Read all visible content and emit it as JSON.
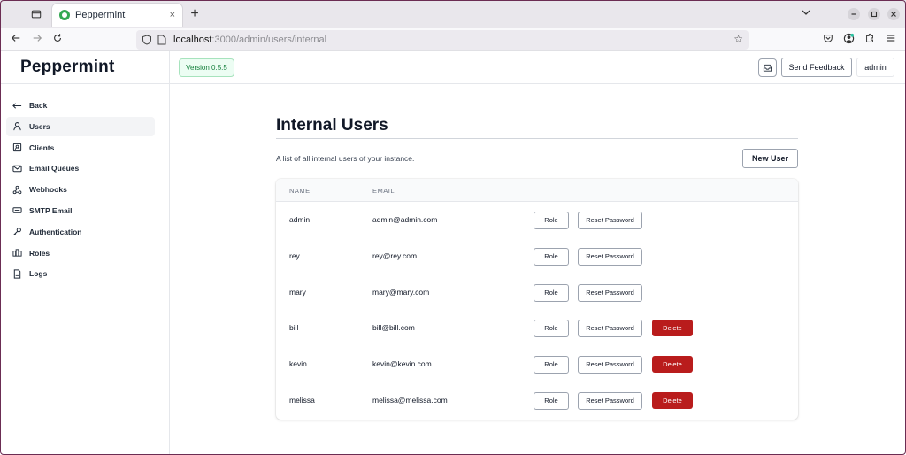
{
  "browser": {
    "tab_title": "Peppermint",
    "tab_close": "×",
    "new_tab": "+",
    "url_host": "localhost",
    "url_path": ":3000/admin/users/internal"
  },
  "app": {
    "brand": "Peppermint",
    "version": "Version 0.5.5",
    "send_feedback": "Send Feedback",
    "user_menu": "admin"
  },
  "sidebar": {
    "items": [
      {
        "label": "Back",
        "icon": "arrow-left-icon",
        "active": false
      },
      {
        "label": "Users",
        "icon": "user-icon",
        "active": true
      },
      {
        "label": "Clients",
        "icon": "contact-card-icon",
        "active": false
      },
      {
        "label": "Email Queues",
        "icon": "mail-icon",
        "active": false
      },
      {
        "label": "Webhooks",
        "icon": "webhook-icon",
        "active": false
      },
      {
        "label": "SMTP Email",
        "icon": "smtp-icon",
        "active": false
      },
      {
        "label": "Authentication",
        "icon": "key-icon",
        "active": false
      },
      {
        "label": "Roles",
        "icon": "roles-icon",
        "active": false
      },
      {
        "label": "Logs",
        "icon": "file-text-icon",
        "active": false
      }
    ]
  },
  "main": {
    "title": "Internal Users",
    "subtitle": "A list of all internal users of your instance.",
    "new_user": "New User",
    "columns": [
      "NAME",
      "EMAIL"
    ],
    "users": [
      {
        "name": "admin",
        "email": "admin@admin.com",
        "deletable": false
      },
      {
        "name": "rey",
        "email": "rey@rey.com",
        "deletable": false
      },
      {
        "name": "mary",
        "email": "mary@mary.com",
        "deletable": false
      },
      {
        "name": "bill",
        "email": "bill@bill.com",
        "deletable": true
      },
      {
        "name": "kevin",
        "email": "kevin@kevin.com",
        "deletable": true
      },
      {
        "name": "melissa",
        "email": "melissa@melissa.com",
        "deletable": true
      }
    ],
    "role_label": "Role",
    "reset_label": "Reset Password",
    "delete_label": "Delete"
  },
  "colors": {
    "delete": "#b91c1c",
    "version_badge": "#15803d",
    "active_nav": "#f3f4f6"
  }
}
